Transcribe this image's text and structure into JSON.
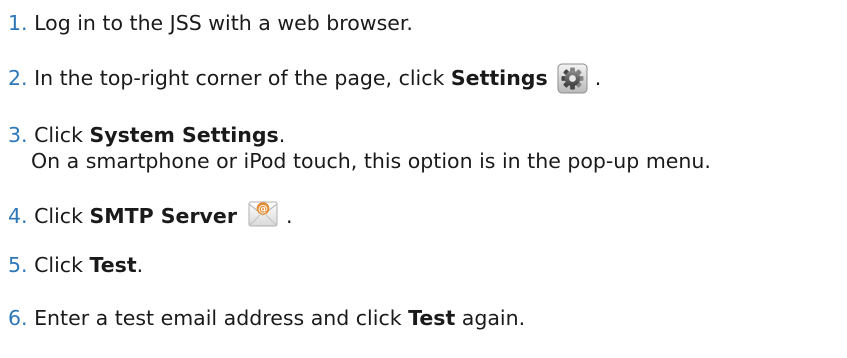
{
  "steps": [
    {
      "number": "1.",
      "text": "Log in to the JSS with a web browser."
    },
    {
      "number": "2.",
      "prefix": "In the top-right corner of the page, click ",
      "bold": "Settings",
      "suffix": " .",
      "icon": "gear-icon"
    },
    {
      "number": "3.",
      "prefix": "Click ",
      "bold": "System Settings",
      "suffix": ".",
      "note": "On a smartphone or iPod touch, this option is in the pop-up menu."
    },
    {
      "number": "4.",
      "prefix": "Click ",
      "bold": "SMTP Server",
      "suffix": " .",
      "icon": "mail-icon"
    },
    {
      "number": "5.",
      "prefix": "Click ",
      "bold": "Test",
      "suffix": "."
    },
    {
      "number": "6.",
      "prefix": "Enter a test email address and click ",
      "bold": "Test",
      "suffix": " again."
    }
  ],
  "colors": {
    "step_number": "#2f78b8",
    "text": "#1a1a1a"
  }
}
